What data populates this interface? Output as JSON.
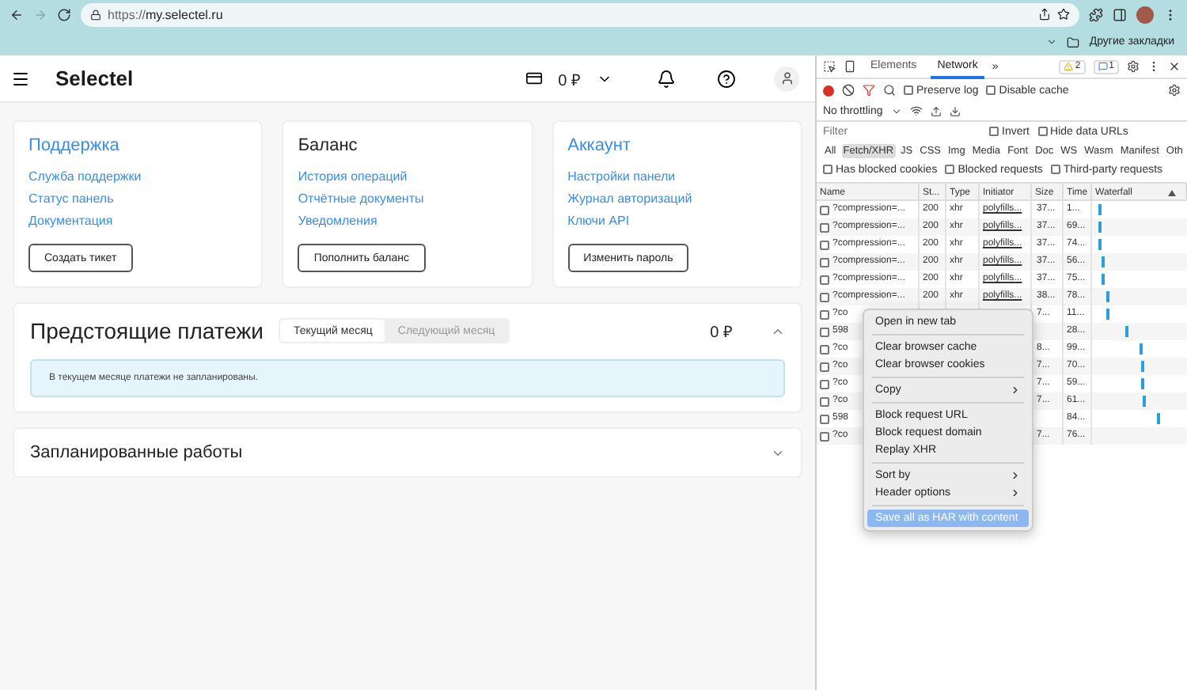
{
  "browser": {
    "url_prefix": "https://",
    "url_host": "my.selectel.ru",
    "bookmarks_folder": "Другие закладки",
    "forward_disabled": true
  },
  "site": {
    "logo": "Selectel",
    "balance": "0 ₽"
  },
  "cards": [
    {
      "title": "Поддержка",
      "title_link": true,
      "links": [
        "Служба поддержки",
        "Статус панель",
        "Документация"
      ],
      "button": "Создать тикет"
    },
    {
      "title": "Баланс",
      "title_link": false,
      "links": [
        "История операций",
        "Отчётные документы",
        "Уведомления"
      ],
      "button": "Пополнить баланс"
    },
    {
      "title": "Аккаунт",
      "title_link": true,
      "links": [
        "Настройки панели",
        "Журнал авторизаций",
        "Ключи API"
      ],
      "button": "Изменить пароль"
    }
  ],
  "payments": {
    "title": "Предстоящие платежи",
    "tabs": [
      {
        "label": "Текущий месяц",
        "selected": true
      },
      {
        "label": "Следующий месяц",
        "selected": false
      }
    ],
    "amount": "0 ₽",
    "expanded": true,
    "notice": "В текущем месяце платежи не запланированы."
  },
  "scheduled": {
    "title": "Запланированные работы",
    "expanded": false
  },
  "devtools": {
    "tabs": [
      {
        "label": "Elements",
        "selected": false
      },
      {
        "label": "Network",
        "selected": true
      }
    ],
    "more": "»",
    "warnings": "2",
    "messages": "1",
    "preserve_log": {
      "label": "Preserve log",
      "checked": false
    },
    "disable_cache": {
      "label": "Disable cache",
      "checked": false
    },
    "throttling": "No throttling",
    "filter": {
      "placeholder": "Filter"
    },
    "invert": {
      "label": "Invert",
      "checked": false
    },
    "hide_data_urls": {
      "label": "Hide data URLs",
      "checked": false
    },
    "types": [
      {
        "label": "All",
        "selected": false
      },
      {
        "label": "Fetch/XHR",
        "selected": true
      },
      {
        "label": "JS",
        "selected": false
      },
      {
        "label": "CSS",
        "selected": false
      },
      {
        "label": "Img",
        "selected": false
      },
      {
        "label": "Media",
        "selected": false
      },
      {
        "label": "Font",
        "selected": false
      },
      {
        "label": "Doc",
        "selected": false
      },
      {
        "label": "WS",
        "selected": false
      },
      {
        "label": "Wasm",
        "selected": false
      },
      {
        "label": "Manifest",
        "selected": false
      },
      {
        "label": "Oth",
        "selected": false
      }
    ],
    "extra_filters": [
      {
        "label": "Has blocked cookies",
        "checked": false
      },
      {
        "label": "Blocked requests",
        "checked": false
      },
      {
        "label": "Third-party requests",
        "checked": false
      }
    ],
    "table": {
      "columns": [
        "Name",
        "St...",
        "Type",
        "Initiator",
        "Size",
        "Time",
        "Waterfall"
      ],
      "rows": [
        {
          "name": "?compression=...",
          "status": "200",
          "type": "xhr",
          "initiator": "polyfills...",
          "size": "37...",
          "time": "1..."
        },
        {
          "name": "?compression=...",
          "status": "200",
          "type": "xhr",
          "initiator": "polyfills...",
          "size": "37...",
          "time": "69..."
        },
        {
          "name": "?compression=...",
          "status": "200",
          "type": "xhr",
          "initiator": "polyfills...",
          "size": "37...",
          "time": "74..."
        },
        {
          "name": "?compression=...",
          "status": "200",
          "type": "xhr",
          "initiator": "polyfills...",
          "size": "37...",
          "time": "56..."
        },
        {
          "name": "?compression=...",
          "status": "200",
          "type": "xhr",
          "initiator": "polyfills...",
          "size": "37...",
          "time": "75..."
        },
        {
          "name": "?compression=...",
          "status": "200",
          "type": "xhr",
          "initiator": "polyfills...",
          "size": "38...",
          "time": "78..."
        },
        {
          "name": "?co",
          "size": "7...",
          "time": "11..."
        },
        {
          "name": "598",
          "time": "28..."
        },
        {
          "name": "?co",
          "size": "8...",
          "time": "99..."
        },
        {
          "name": "?co",
          "size": "7...",
          "time": "70..."
        },
        {
          "name": "?co",
          "size": "7...",
          "time": "59..."
        },
        {
          "name": "?co",
          "size": "7...",
          "time": "61..."
        },
        {
          "name": "598",
          "time": "84..."
        },
        {
          "name": "?co",
          "size": "7...",
          "time": "76..."
        }
      ]
    },
    "context_menu": [
      [
        {
          "label": "Open in new tab",
          "submenu": false,
          "selected": false
        }
      ],
      [
        {
          "label": "Clear browser cache",
          "submenu": false,
          "selected": false
        },
        {
          "label": "Clear browser cookies",
          "submenu": false,
          "selected": false
        }
      ],
      [
        {
          "label": "Copy",
          "submenu": true,
          "selected": false
        }
      ],
      [
        {
          "label": "Block request URL",
          "submenu": false,
          "selected": false
        },
        {
          "label": "Block request domain",
          "submenu": false,
          "selected": false
        },
        {
          "label": "Replay XHR",
          "submenu": false,
          "selected": false
        }
      ],
      [
        {
          "label": "Sort by",
          "submenu": true,
          "selected": false
        },
        {
          "label": "Header options",
          "submenu": true,
          "selected": false
        }
      ],
      [
        {
          "label": "Save all as HAR with content",
          "submenu": false,
          "selected": true
        }
      ]
    ]
  }
}
